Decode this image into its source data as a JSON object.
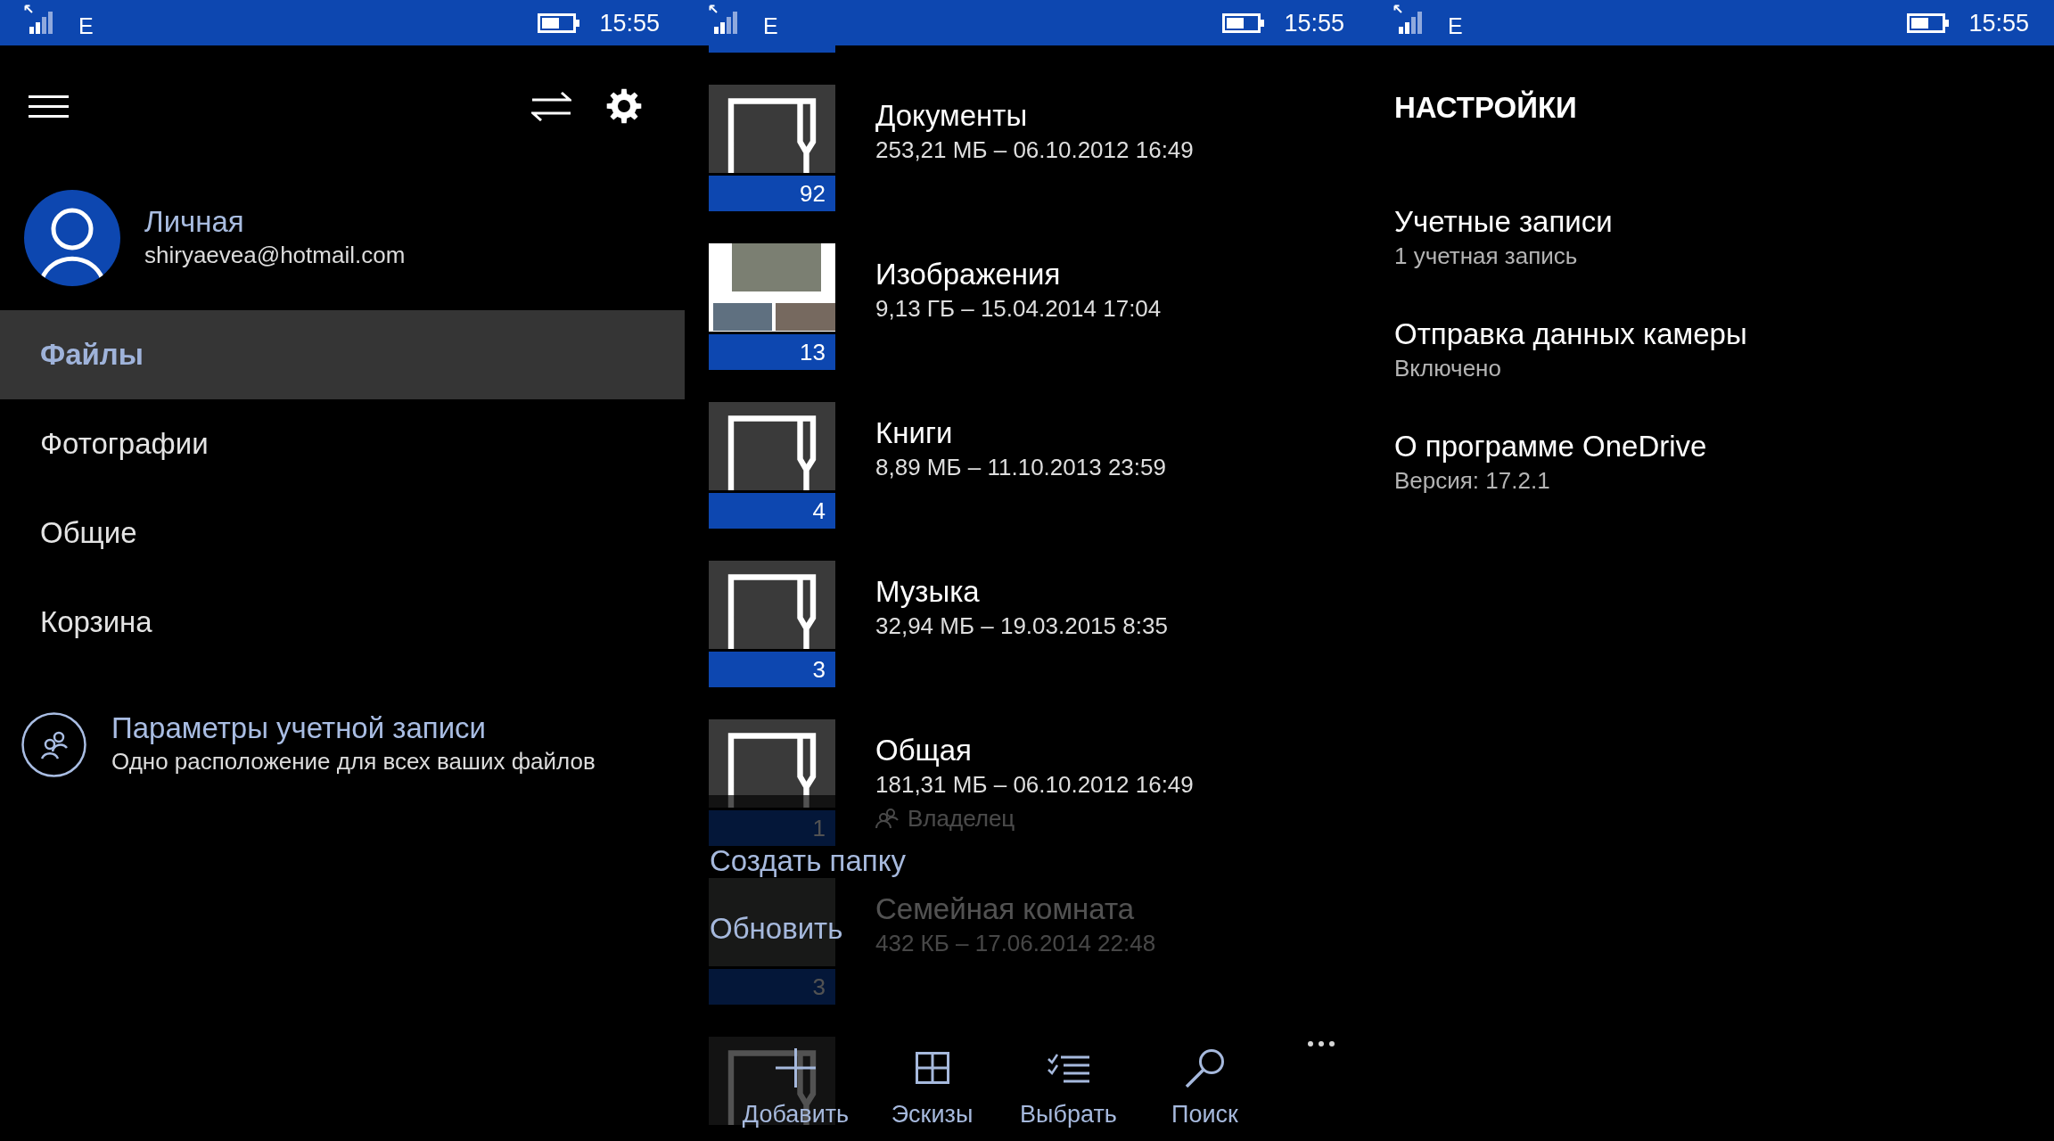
{
  "navigation_pane": {
    "status_bar": {
      "network": "E",
      "time": "15:55"
    },
    "account": {
      "name": "Личная",
      "email": "shiryaevea@hotmail.com"
    },
    "items": [
      {
        "label": "Файлы",
        "selected": true
      },
      {
        "label": "Фотографии",
        "selected": false
      },
      {
        "label": "Общие",
        "selected": false
      },
      {
        "label": "Корзина",
        "selected": false
      }
    ],
    "account_settings": {
      "title": "Параметры учетной записи",
      "subtitle": "Одно расположение для всех ваших файлов"
    }
  },
  "files_pane": {
    "status_bar": {
      "network": "E",
      "time": "15:55"
    },
    "folders": [
      {
        "kind": "folder",
        "name": "Документы",
        "details": "253,21 МБ – 06.10.2012 16:49",
        "count": "92"
      },
      {
        "kind": "collage",
        "name": "Изображения",
        "details": "9,13 ГБ – 15.04.2014 17:04",
        "count": "13"
      },
      {
        "kind": "folder",
        "name": "Книги",
        "details": "8,89 МБ – 11.10.2013 23:59",
        "count": "4"
      },
      {
        "kind": "folder",
        "name": "Музыка",
        "details": "32,94 МБ – 19.03.2015 8:35",
        "count": "3"
      },
      {
        "kind": "folder",
        "name": "Общая",
        "details": "181,31 МБ – 06.10.2012 16:49",
        "owner": "Владелец",
        "count": "1"
      },
      {
        "kind": "photo",
        "name": "Семейная комната",
        "details": "432 КБ – 17.06.2014 22:48",
        "count": "3"
      },
      {
        "kind": "folder"
      }
    ],
    "menu": {
      "expanded": true,
      "items": [
        "Создать папку",
        "Обновить"
      ]
    },
    "app_bar": [
      {
        "kind": "add",
        "label": "Добавить"
      },
      {
        "kind": "thumbnails",
        "label": "Эскизы"
      },
      {
        "kind": "select",
        "label": "Выбрать"
      },
      {
        "kind": "search",
        "label": "Поиск"
      }
    ]
  },
  "settings_pane": {
    "status_bar": {
      "network": "E",
      "time": "15:55"
    },
    "title": "НАСТРОЙКИ",
    "items": [
      {
        "title": "Учетные записи",
        "value": "1 учетная запись"
      },
      {
        "title": "Отправка данных камеры",
        "value": "Включено"
      },
      {
        "title": "О программе OneDrive",
        "value": "Версия: 17.2.1"
      }
    ]
  }
}
